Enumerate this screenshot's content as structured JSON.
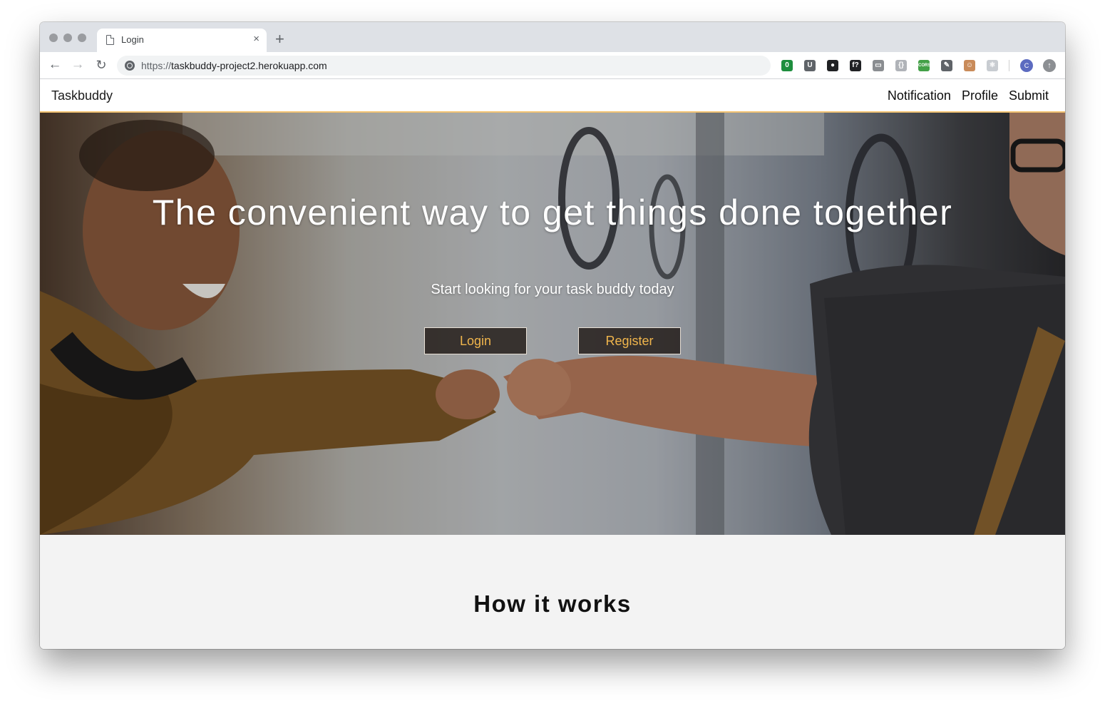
{
  "browser": {
    "tab_title": "Login",
    "tab_close": "×",
    "new_tab": "+",
    "url_scheme": "https://",
    "url_host": "taskbuddy-project2.herokuapp.com",
    "nav": {
      "back": "←",
      "forward": "→",
      "reload": "↻"
    },
    "extensions": [
      {
        "name": "tampermonkey-icon",
        "text": "0",
        "color": "#1e8e3e"
      },
      {
        "name": "ublock-icon",
        "text": "U",
        "color": "#5f6368"
      },
      {
        "name": "ghostery-icon",
        "text": "●",
        "color": "#202124"
      },
      {
        "name": "fontface-icon",
        "text": "f?",
        "color": "#202124"
      },
      {
        "name": "screenshot-icon",
        "text": "▭",
        "color": "#8a8d91"
      },
      {
        "name": "json-icon",
        "text": "{}",
        "color": "#b0b3b8"
      },
      {
        "name": "cors-icon",
        "text": "CORS",
        "color": "#43a047"
      },
      {
        "name": "devtools-icon",
        "text": "✎",
        "color": "#5f6368"
      },
      {
        "name": "character-icon",
        "text": "☺",
        "color": "#c98b5a"
      },
      {
        "name": "react-icon",
        "text": "⚛",
        "color": "#c8ccd1"
      }
    ],
    "avatar_letter": "C",
    "update_glyph": "↑"
  },
  "site": {
    "brand": "Taskbuddy",
    "nav_links": [
      "Notification",
      "Profile",
      "Submit"
    ],
    "accent_color": "#f3c372"
  },
  "hero": {
    "title": "The convenient way to get things done together",
    "subtitle": "Start looking for your task buddy today",
    "login_label": "Login",
    "register_label": "Register",
    "button_text_color": "#f0b54c"
  },
  "how": {
    "title": "How it works"
  }
}
